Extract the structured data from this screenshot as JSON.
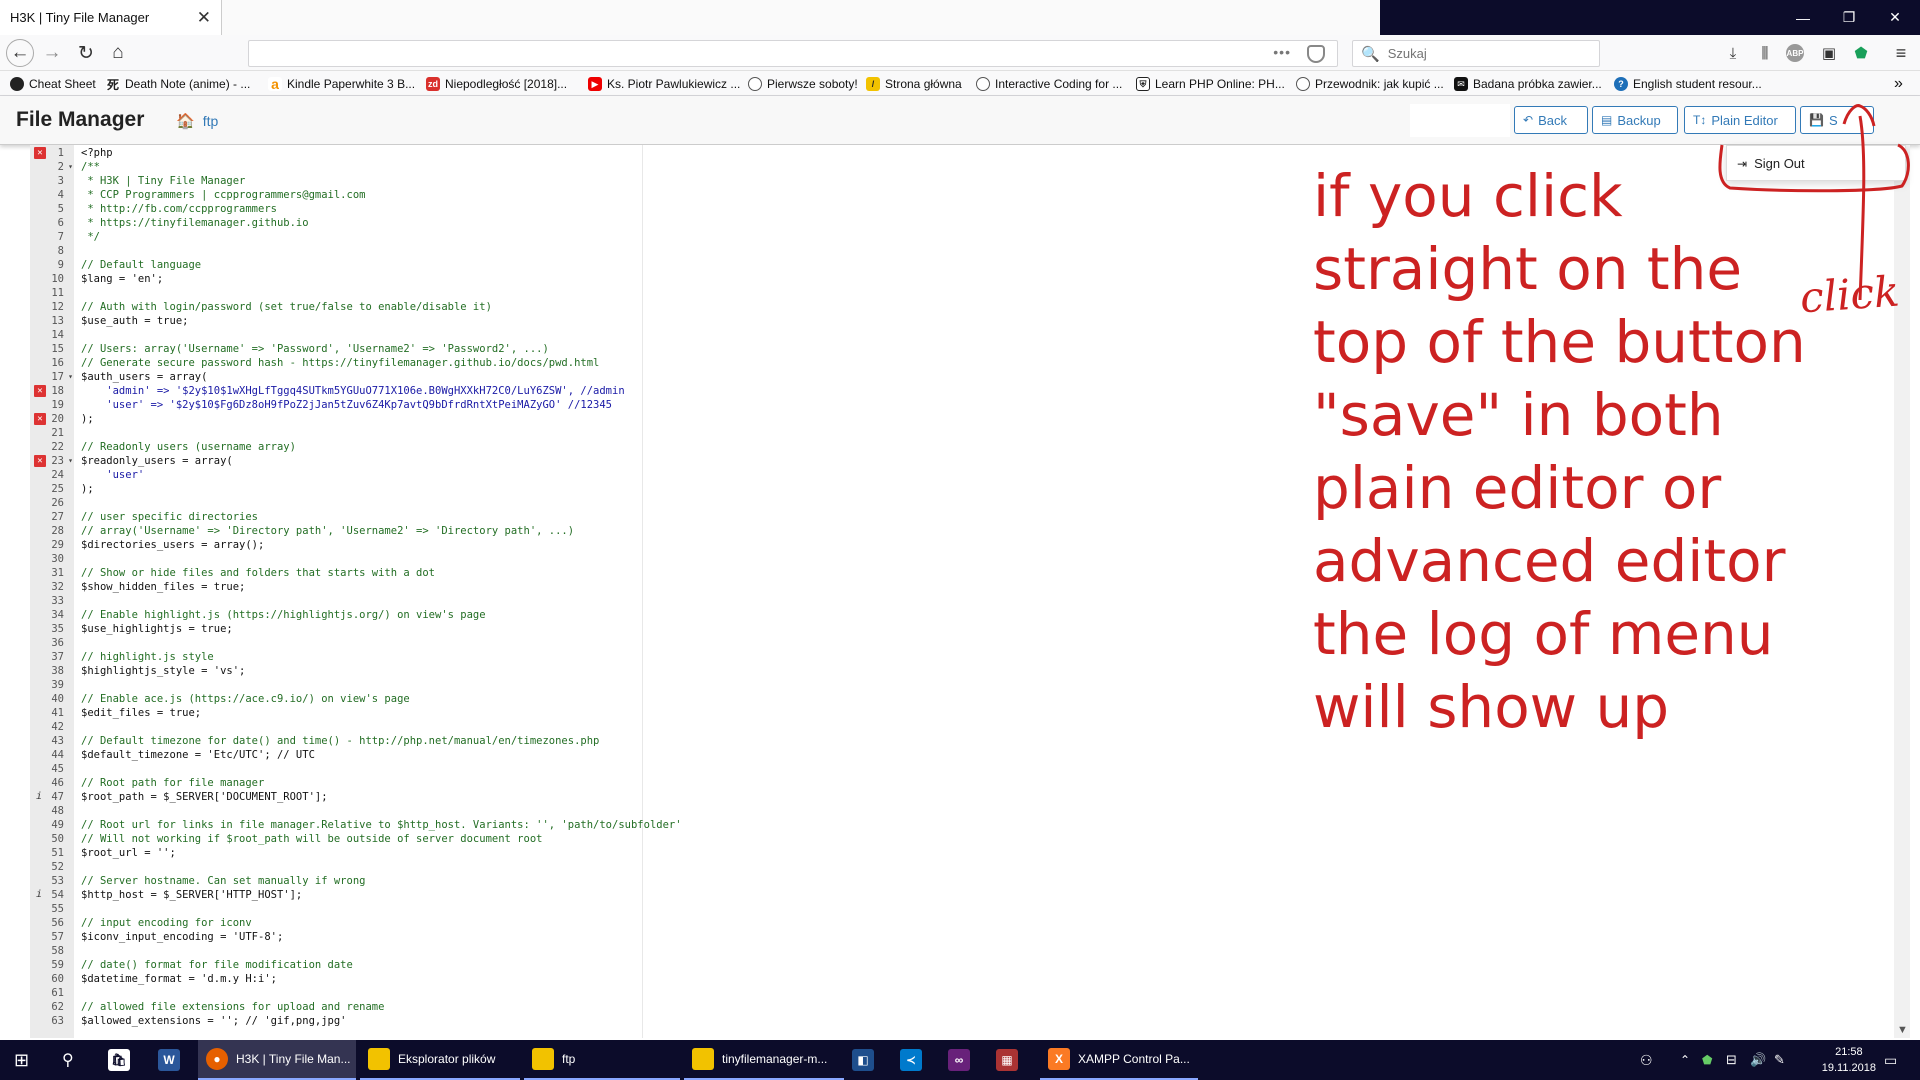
{
  "browser": {
    "tab_title": "H3K | Tiny File Manager",
    "tab_close": "✕",
    "search_placeholder": "Szukaj",
    "url_dots": "•••",
    "window_controls": {
      "minimize": "—",
      "maximize": "❐",
      "close": "✕"
    },
    "bookmarks": [
      "Cheat Sheet",
      "Death Note (anime) - ...",
      "Kindle Paperwhite 3 B...",
      "Niepodległość [2018]...",
      "Ks. Piotr Pawlukiewicz ...",
      "Pierwsze soboty!",
      "Strona główna",
      "Interactive Coding for ...",
      "Learn PHP Online: PH...",
      "Przewodnik: jak kupić ...",
      "Badana próbka zawier...",
      "English student resour..."
    ],
    "bookmark_overflow": "»"
  },
  "app": {
    "title": "File Manager",
    "breadcrumb": "ftp",
    "buttons": {
      "back": "Back",
      "backup": "Backup",
      "plain_editor": "Plain Editor",
      "save": "S"
    },
    "dropdown": {
      "sign_out": "Sign Out"
    }
  },
  "editor": {
    "lines": [
      "<?php",
      "/**",
      " * H3K | Tiny File Manager",
      " * CCP Programmers | ccpprogrammers@gmail.com",
      " * http://fb.com/ccpprogrammers",
      " * https://tinyfilemanager.github.io",
      " */",
      "",
      "// Default language",
      "$lang = 'en';",
      "",
      "// Auth with login/password (set true/false to enable/disable it)",
      "$use_auth = true;",
      "",
      "// Users: array('Username' => 'Password', 'Username2' => 'Password2', ...)",
      "// Generate secure password hash - https://tinyfilemanager.github.io/docs/pwd.html",
      "$auth_users = array(",
      "    'admin' => '$2y$10$1wXHgLfTggq4SUTkm5YGUuO771X106e.B0WgHXXkH72C0/LuY6ZSW', //admin",
      "    'user' => '$2y$10$Fg6Dz8oH9fPoZ2jJan5tZuv6Z4Kp7avtQ9bDfrdRntXtPeiMAZyGO' //12345",
      ");",
      "",
      "// Readonly users (username array)",
      "$readonly_users = array(",
      "    'user'",
      ");",
      "",
      "// user specific directories",
      "// array('Username' => 'Directory path', 'Username2' => 'Directory path', ...)",
      "$directories_users = array();",
      "",
      "// Show or hide files and folders that starts with a dot",
      "$show_hidden_files = true;",
      "",
      "// Enable highlight.js (https://highlightjs.org/) on view's page",
      "$use_highlightjs = true;",
      "",
      "// highlight.js style",
      "$highlightjs_style = 'vs';",
      "",
      "// Enable ace.js (https://ace.c9.io/) on view's page",
      "$edit_files = true;",
      "",
      "// Default timezone for date() and time() - http://php.net/manual/en/timezones.php",
      "$default_timezone = 'Etc/UTC'; // UTC",
      "",
      "// Root path for file manager",
      "$root_path = $_SERVER['DOCUMENT_ROOT'];",
      "",
      "// Root url for links in file manager.Relative to $http_host. Variants: '', 'path/to/subfolder'",
      "// Will not working if $root_path will be outside of server document root",
      "$root_url = '';",
      "",
      "// Server hostname. Can set manually if wrong",
      "$http_host = $_SERVER['HTTP_HOST'];",
      "",
      "// input encoding for iconv",
      "$iconv_input_encoding = 'UTF-8';",
      "",
      "// date() format for file modification date",
      "$datetime_format = 'd.m.y H:i';",
      "",
      "// allowed file extensions for upload and rename",
      "$allowed_extensions = ''; // 'gif,png,jpg'"
    ],
    "error_lines": [
      1,
      18,
      20,
      23
    ],
    "info_lines": [
      47,
      54
    ],
    "fold_lines": [
      2,
      17,
      23
    ]
  },
  "annotation": {
    "main": "if you click straight on the top of the button \"save\" in both plain editor or advanced editor the log of menu will show up",
    "click": "click"
  },
  "taskbar": {
    "items": [
      "H3K | Tiny File Man...",
      "Eksplorator plików",
      "ftp",
      "tinyfilemanager-m...",
      "XAMPP Control Pa..."
    ],
    "time": "21:58",
    "date": "19.11.2018"
  },
  "colors": {
    "annotation_red": "#cc2222",
    "link_blue": "#337ab7",
    "taskbar_bg": "#0c0c2a"
  }
}
